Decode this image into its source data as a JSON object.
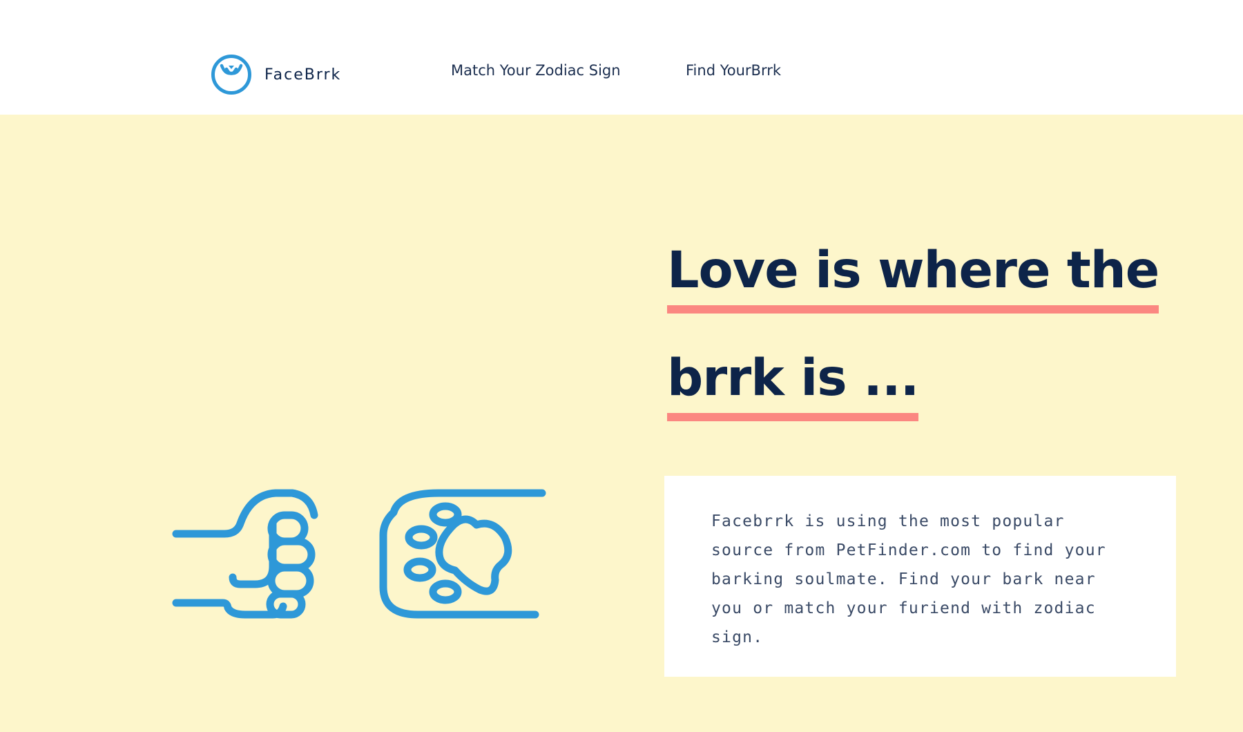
{
  "header": {
    "brand": {
      "logo_icon": "dog-face-circle-icon",
      "name": "FaceBrrk"
    },
    "nav": [
      {
        "label": "Match Your Zodiac Sign"
      },
      {
        "label": "Find YourBrrk"
      }
    ]
  },
  "hero": {
    "headline": {
      "line1": "Love is where the",
      "line2": "brrk is ..."
    },
    "illustration": {
      "left_icon": "fist-icon",
      "right_icon": "paw-icon"
    },
    "intro": "Facebrrk is using the most popular source from PetFinder.com to find your barking soulmate. Find your bark near you or match your furiend with zodiac sign."
  },
  "colors": {
    "hero_background": "#fdf6cb",
    "navy_text": "#0d2449",
    "underline_accent": "#fb8781",
    "icon_blue": "#2e98d8",
    "card_background": "#ffffff"
  }
}
